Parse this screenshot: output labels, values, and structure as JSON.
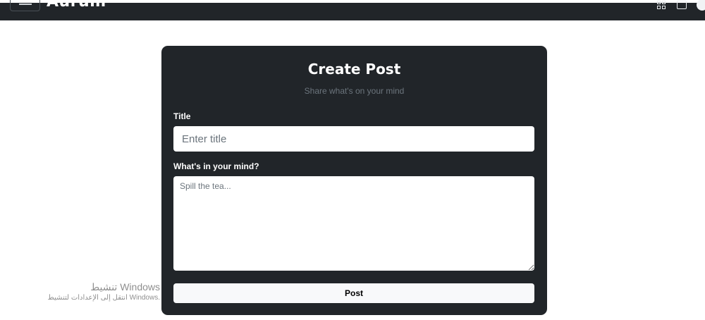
{
  "header": {
    "brand": "Aurum",
    "icons": [
      "menu-icon",
      "grid-icon",
      "window-icon",
      "profile-icon"
    ]
  },
  "post_form": {
    "title": "Create Post",
    "subtitle": "Share what's on your mind",
    "title_label": "Title",
    "title_placeholder": "Enter title",
    "title_value": "",
    "content_label": "What's in your mind?",
    "content_placeholder": "Spill the tea...",
    "content_value": "",
    "submit_label": "Post"
  },
  "os_watermark": {
    "line1": "تنشيط Windows",
    "line2": "انتقل إلى الإعدادات لتنشيط Windows."
  },
  "colors": {
    "navbar_bg": "#212529",
    "card_bg": "#212529",
    "page_bg": "#ffffff",
    "button_bg": "#f8f9fa",
    "subtitle": "#6c757d"
  }
}
